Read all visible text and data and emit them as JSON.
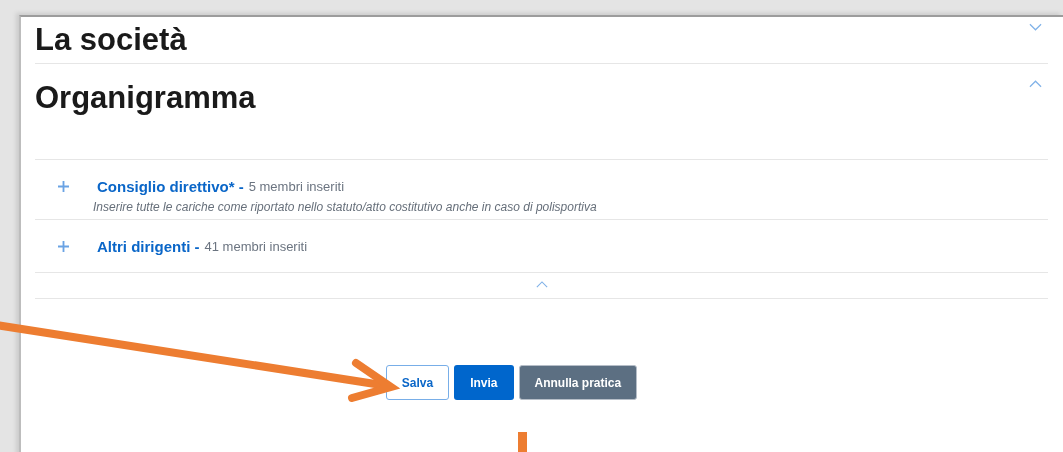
{
  "sections": [
    {
      "title": "La società",
      "expanded": false
    },
    {
      "title": "Organigramma",
      "expanded": true,
      "groups": [
        {
          "title": "Consiglio direttivo* -",
          "count": "5 membri inseriti",
          "note": "Inserire tutte le cariche come riportato nello statuto/atto costitutivo anche in caso di polisportiva",
          "expanded": false
        },
        {
          "title": "Altri dirigenti -",
          "count": "41 membri inseriti",
          "expanded": false
        }
      ]
    }
  ],
  "buttons": [
    {
      "label": "Salva",
      "kind": "outline"
    },
    {
      "label": "Invia",
      "kind": "primary"
    },
    {
      "label": "Annulla pratica",
      "kind": "secondary"
    }
  ]
}
